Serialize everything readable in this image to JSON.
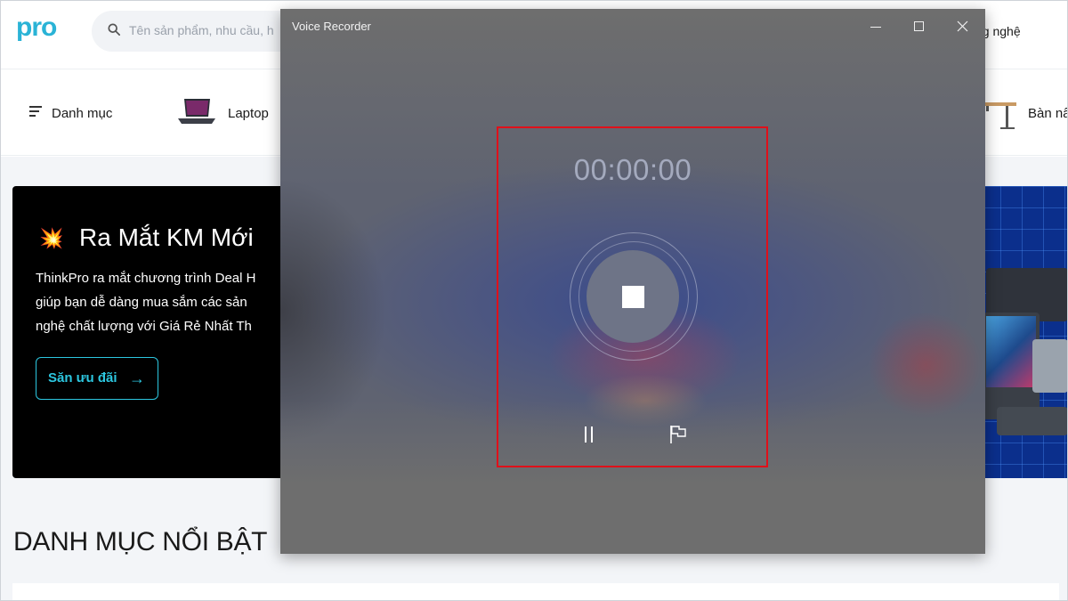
{
  "site": {
    "logo": "pro",
    "search_placeholder": "Tên sản phẩm, nhu cầu, h",
    "right_nav_label": "ng nghệ",
    "categories": [
      {
        "label": "Danh mục"
      },
      {
        "label": "Laptop"
      },
      {
        "label": "Bàn nâ"
      }
    ],
    "promo": {
      "burst_icon": "💥",
      "title": "Ra Mắt KM Mới",
      "body": "ThinkPro ra mắt chương trình Deal H\ngiúp bạn dễ dàng mua sắm các sản\nnghệ chất lượng với Giá Rẻ Nhất Th",
      "button_label": "Săn ưu đãi",
      "button_arrow": "→"
    },
    "section_title": "DANH MỤC NỔI BẬT"
  },
  "voice_recorder": {
    "window_title": "Voice Recorder",
    "timer": "00:00:00",
    "buttons": {
      "minimize": "minimize",
      "maximize": "maximize",
      "close": "close",
      "stop": "stop",
      "pause": "pause",
      "marker": "add marker"
    },
    "highlight_color": "#e0101a"
  }
}
